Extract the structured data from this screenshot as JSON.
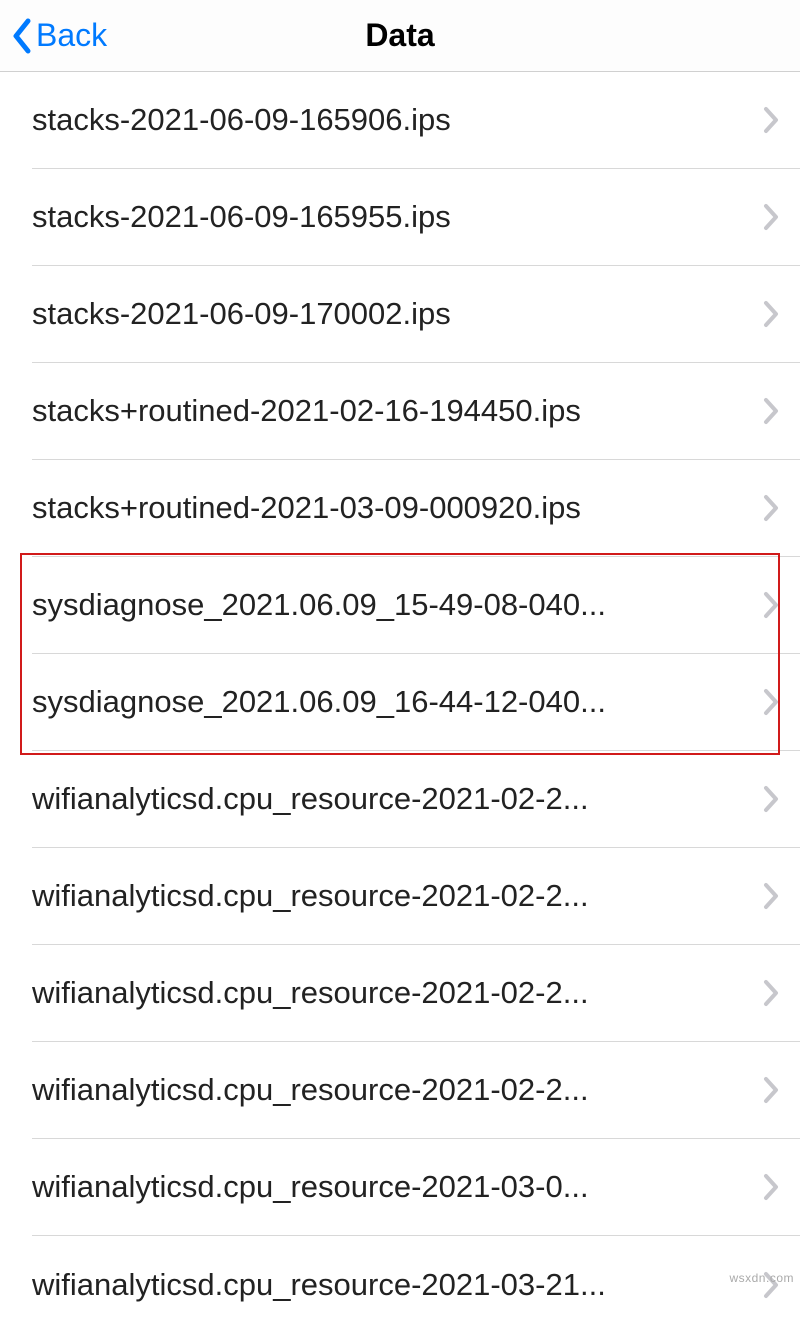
{
  "header": {
    "back_label": "Back",
    "title": "Data"
  },
  "items": [
    {
      "label": "stacks-2021-06-09-165906.ips"
    },
    {
      "label": "stacks-2021-06-09-165955.ips"
    },
    {
      "label": "stacks-2021-06-09-170002.ips"
    },
    {
      "label": "stacks+routined-2021-02-16-194450.ips"
    },
    {
      "label": "stacks+routined-2021-03-09-000920.ips"
    },
    {
      "label": "sysdiagnose_2021.06.09_15-49-08-040..."
    },
    {
      "label": "sysdiagnose_2021.06.09_16-44-12-040..."
    },
    {
      "label": "wifianalyticsd.cpu_resource-2021-02-2..."
    },
    {
      "label": "wifianalyticsd.cpu_resource-2021-02-2..."
    },
    {
      "label": "wifianalyticsd.cpu_resource-2021-02-2..."
    },
    {
      "label": "wifianalyticsd.cpu_resource-2021-02-2..."
    },
    {
      "label": "wifianalyticsd.cpu_resource-2021-03-0..."
    },
    {
      "label": "wifianalyticsd.cpu_resource-2021-03-21..."
    }
  ],
  "highlight": {
    "start_index": 5,
    "end_index": 6
  },
  "watermark": "wsxdn.com"
}
